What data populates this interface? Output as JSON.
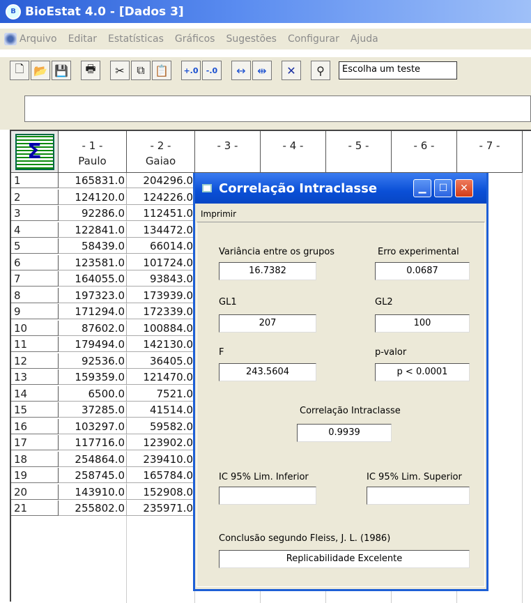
{
  "window": {
    "title": "BioEstat 4.0 - [Dados 3]"
  },
  "menu": [
    "Arquivo",
    "Editar",
    "Estatísticas",
    "Gráficos",
    "Sugestões",
    "Configurar",
    "Ajuda"
  ],
  "toolbar": {
    "test_combo_value": "Escolha um teste",
    "btn_round_1": "+.0",
    "btn_round_2": "-.0"
  },
  "grid": {
    "columns": [
      {
        "num": "- 1 -",
        "name": "Paulo"
      },
      {
        "num": "- 2 -",
        "name": "Gaiao"
      },
      {
        "num": "- 3 -",
        "name": ""
      },
      {
        "num": "- 4 -",
        "name": ""
      },
      {
        "num": "- 5 -",
        "name": ""
      },
      {
        "num": "- 6 -",
        "name": ""
      },
      {
        "num": "- 7 -",
        "name": ""
      }
    ],
    "rows": [
      [
        "1",
        "165831.0",
        "204296.0"
      ],
      [
        "2",
        "124120.0",
        "124226.0"
      ],
      [
        "3",
        "92286.0",
        "112451.0"
      ],
      [
        "4",
        "122841.0",
        "134472.0"
      ],
      [
        "5",
        "58439.0",
        "66014.0"
      ],
      [
        "6",
        "123581.0",
        "101724.0"
      ],
      [
        "7",
        "164055.0",
        "93843.0"
      ],
      [
        "8",
        "197323.0",
        "173939.0"
      ],
      [
        "9",
        "171294.0",
        "172339.0"
      ],
      [
        "10",
        "87602.0",
        "100884.0"
      ],
      [
        "11",
        "179494.0",
        "142130.0"
      ],
      [
        "12",
        "92536.0",
        "36405.0"
      ],
      [
        "13",
        "159359.0",
        "121470.0"
      ],
      [
        "14",
        "6500.0",
        "7521.0"
      ],
      [
        "15",
        "37285.0",
        "41514.0"
      ],
      [
        "16",
        "103297.0",
        "59582.0"
      ],
      [
        "17",
        "117716.0",
        "123902.0"
      ],
      [
        "18",
        "254864.0",
        "239410.0"
      ],
      [
        "19",
        "258745.0",
        "165784.0"
      ],
      [
        "20",
        "143910.0",
        "152908.0"
      ],
      [
        "21",
        "255802.0",
        "235971.0"
      ]
    ]
  },
  "dialog": {
    "title": "Correlação Intraclasse",
    "menu_print": "Imprimir",
    "var_label": "Variância entre os grupos",
    "var_value": "16.7382",
    "err_label": "Erro experimental",
    "err_value": "0.0687",
    "gl1_label": "GL1",
    "gl1_value": "207",
    "gl2_label": "GL2",
    "gl2_value": "100",
    "f_label": "F",
    "f_value": "243.5604",
    "p_label": "p-valor",
    "p_value": "p < 0.0001",
    "icc_label": "Correlação Intraclasse",
    "icc_value": "0.9939",
    "ci_low_label": "IC 95% Lim. Inferior",
    "ci_low_value": "",
    "ci_high_label": "IC 95% Lim. Superior",
    "ci_high_value": "",
    "concl_label": "Conclusão segundo Fleiss, J. L. (1986)",
    "concl_value": "Replicabilidade Excelente"
  }
}
